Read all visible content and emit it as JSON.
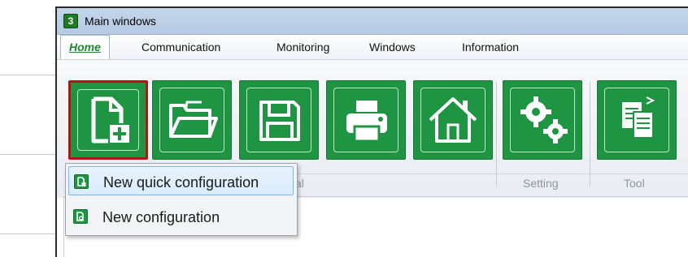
{
  "window": {
    "title": "Main windows",
    "app_icon_text": "3"
  },
  "menubar": {
    "items": [
      {
        "label": "Home",
        "active": true
      },
      {
        "label": "Communication"
      },
      {
        "label": "Monitoring"
      },
      {
        "label": "Windows"
      },
      {
        "label": "Information"
      }
    ]
  },
  "ribbon": {
    "buttons": [
      {
        "icon": "new-file-plus-icon",
        "active": true
      },
      {
        "icon": "open-folder-icon"
      },
      {
        "icon": "save-floppy-icon"
      },
      {
        "icon": "print-icon"
      },
      {
        "icon": "home-icon"
      },
      {
        "icon": "settings-gears-icon"
      },
      {
        "icon": "tool-documents-icon"
      }
    ],
    "group_labels": {
      "general_partial": "al",
      "setting": "Setting",
      "tool": "Tool"
    },
    "colors": {
      "button_green": "#1f9442",
      "active_border": "#b31515"
    }
  },
  "dropdown": {
    "items": [
      {
        "label": "New quick configuration",
        "icon": "quick-config-icon",
        "selected": true
      },
      {
        "label": "New configuration",
        "icon": "config-icon",
        "selected": false
      }
    ]
  }
}
